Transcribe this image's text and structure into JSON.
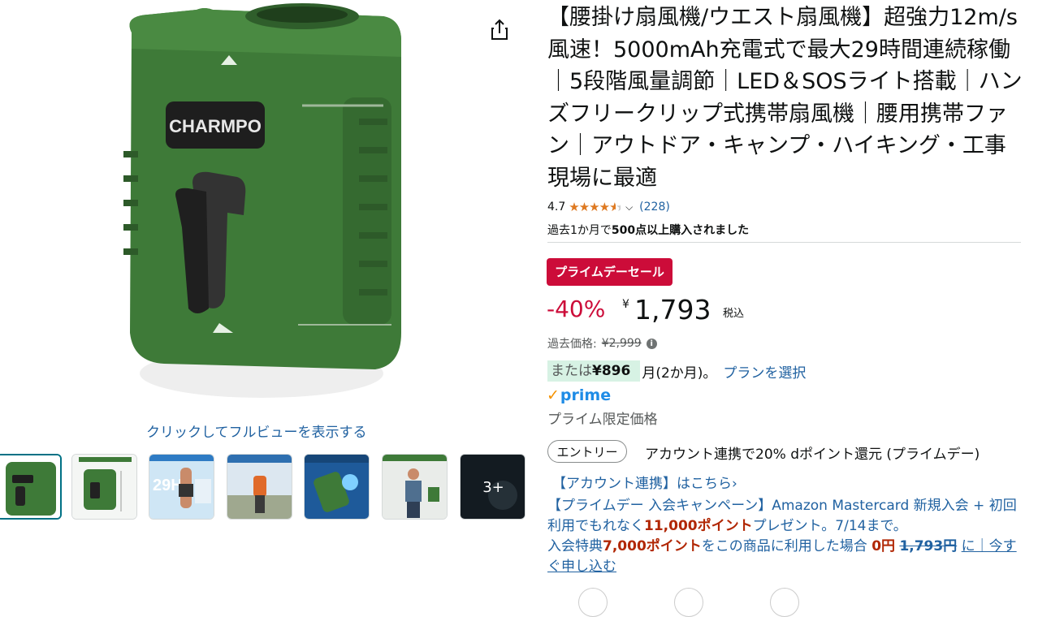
{
  "image": {
    "fullview_label": "クリックしてフルビューを表示する",
    "brand_text": "CHARMPO",
    "more_label": "3+"
  },
  "title": "【腰掛け扇風機/ウエスト扇風機】超強力12m/s風速！5000mAh充電式で最大29時間連続稼働｜5段階風量調節｜LED＆SOSライト搭載｜ハンズフリークリップ式携帯扇風機｜腰用携帯ファン｜アウトドア・キャンプ・ハイキング・工事現場に最適",
  "rating": {
    "value": "4.7",
    "stars": 4.7,
    "count": "(228)"
  },
  "bought": {
    "prefix": "過去1か月で",
    "bold": "500点以上購入されました"
  },
  "deal": {
    "badge": "プライムデーセール",
    "discount": "-40%",
    "currency": "¥",
    "price": "1,793",
    "tax": "税込"
  },
  "past": {
    "label": "過去価格:",
    "price": "¥2,999"
  },
  "installment": {
    "prefix": "または",
    "amount": "¥896",
    "period": "月(2か月)。",
    "plan_link": "プランを選択"
  },
  "prime": {
    "check": "✓",
    "logo": "prime",
    "only": "プライム限定価格"
  },
  "entry": {
    "button": "エントリー",
    "text": "アカウント連携で20% dポイント還元 (プライムデー)"
  },
  "account_link": "【アカウント連携】はこちら›",
  "promo": {
    "line1": "【プライムデー 入会キャンペーン】Amazon Mastercard 新規入会 + 初回利用でもれなく",
    "points1": "11,000ポイント",
    "line1b": "プレゼント。7/14まで。",
    "line2": "入会特典",
    "points2": "7,000ポイント",
    "line2b": "をこの商品に利用した場合",
    "zero": "0円",
    "orig": "1,793円",
    "line2c": "に｜今すぐ申し込む"
  },
  "colors": {
    "deal_red": "#cc0c39",
    "link_blue": "#2162a1",
    "prime_blue": "#1f8ce6",
    "product_green": "#3f7a3a"
  }
}
